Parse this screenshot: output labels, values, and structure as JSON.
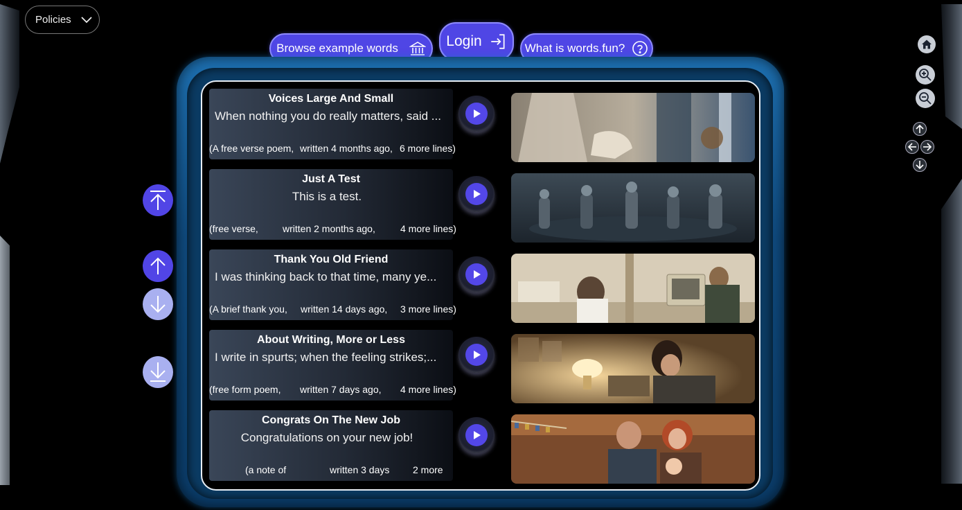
{
  "header": {
    "policies_label": "Policies",
    "browse_label": "Browse example words",
    "login_label": "Login",
    "what_label": "What is words.fun?"
  },
  "colors": {
    "accent": "#4f46e5",
    "frame": "#0f4a7e",
    "disabled": "#a9b0f0"
  },
  "items": [
    {
      "title": "Voices Large And Small",
      "excerpt": "When nothing you do really matters, said ...",
      "meta": [
        "(A free verse poem,",
        "written 4 months ago,",
        "6 more lines)"
      ],
      "image": "statue-scene"
    },
    {
      "title": "Just A Test",
      "excerpt": "This is a test.",
      "meta": [
        "(free verse,",
        "written 2 months ago,",
        "4 more lines)"
      ],
      "image": "robots-scene"
    },
    {
      "title": "Thank You Old Friend",
      "excerpt": "I was thinking back to that time, many ye...",
      "meta": [
        "(A brief thank you,",
        "written 14 days ago,",
        "3 more lines)"
      ],
      "image": "office-computer-scene"
    },
    {
      "title": "About Writing, More or Less",
      "excerpt": "I write in spurts; when the feeling strikes;...",
      "meta": [
        "(free form poem,",
        "written 7 days ago,",
        "4 more lines)"
      ],
      "image": "writer-scene"
    },
    {
      "title": "Congrats On The New Job",
      "excerpt": "Congratulations on your new job!",
      "meta": [
        "(a note of",
        "written 3 days",
        "2 more"
      ],
      "image": "family-scene"
    }
  ],
  "icons": {
    "policies": "chevron-down-icon",
    "browse": "bank-icon",
    "login": "login-icon",
    "what": "question-icon",
    "play": "play-icon",
    "home": "home-icon",
    "zoom_in": "zoom-in-icon",
    "zoom_out": "zoom-out-icon"
  }
}
